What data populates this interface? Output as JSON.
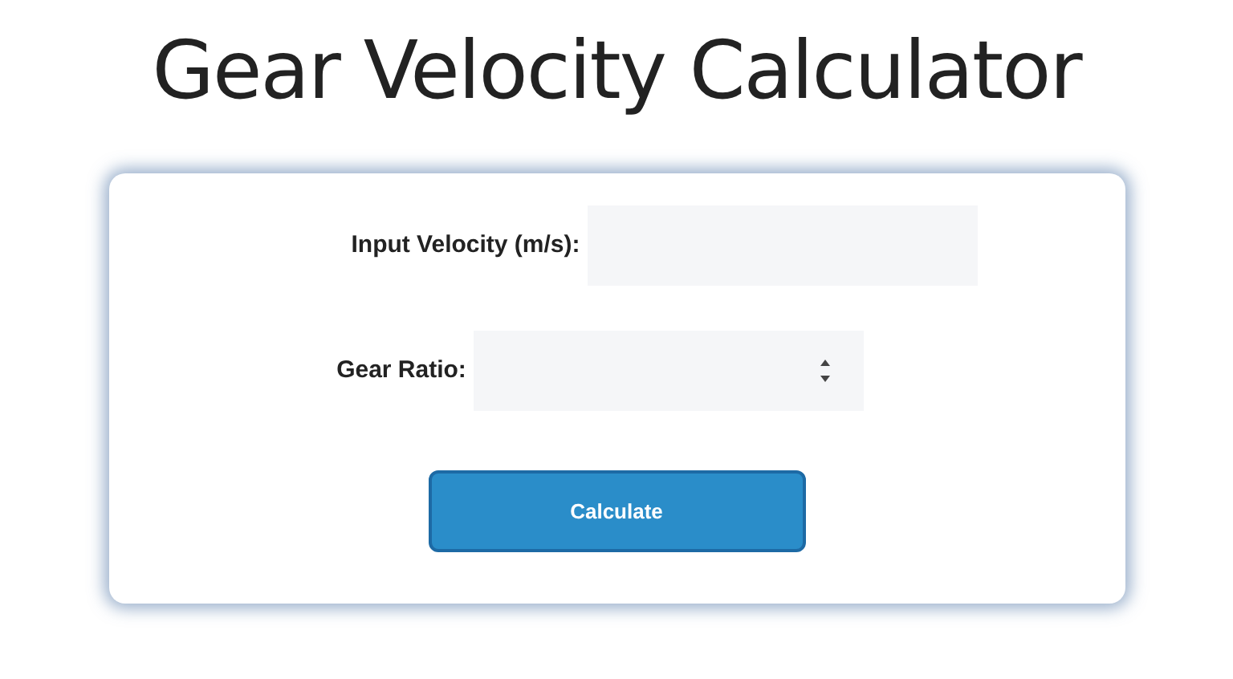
{
  "title": "Gear Velocity Calculator",
  "fields": [
    {
      "label": "Input Velocity (m/s):",
      "kind": "text"
    },
    {
      "label": "Gear Ratio:",
      "kind": "number"
    }
  ],
  "button": "Calculate"
}
